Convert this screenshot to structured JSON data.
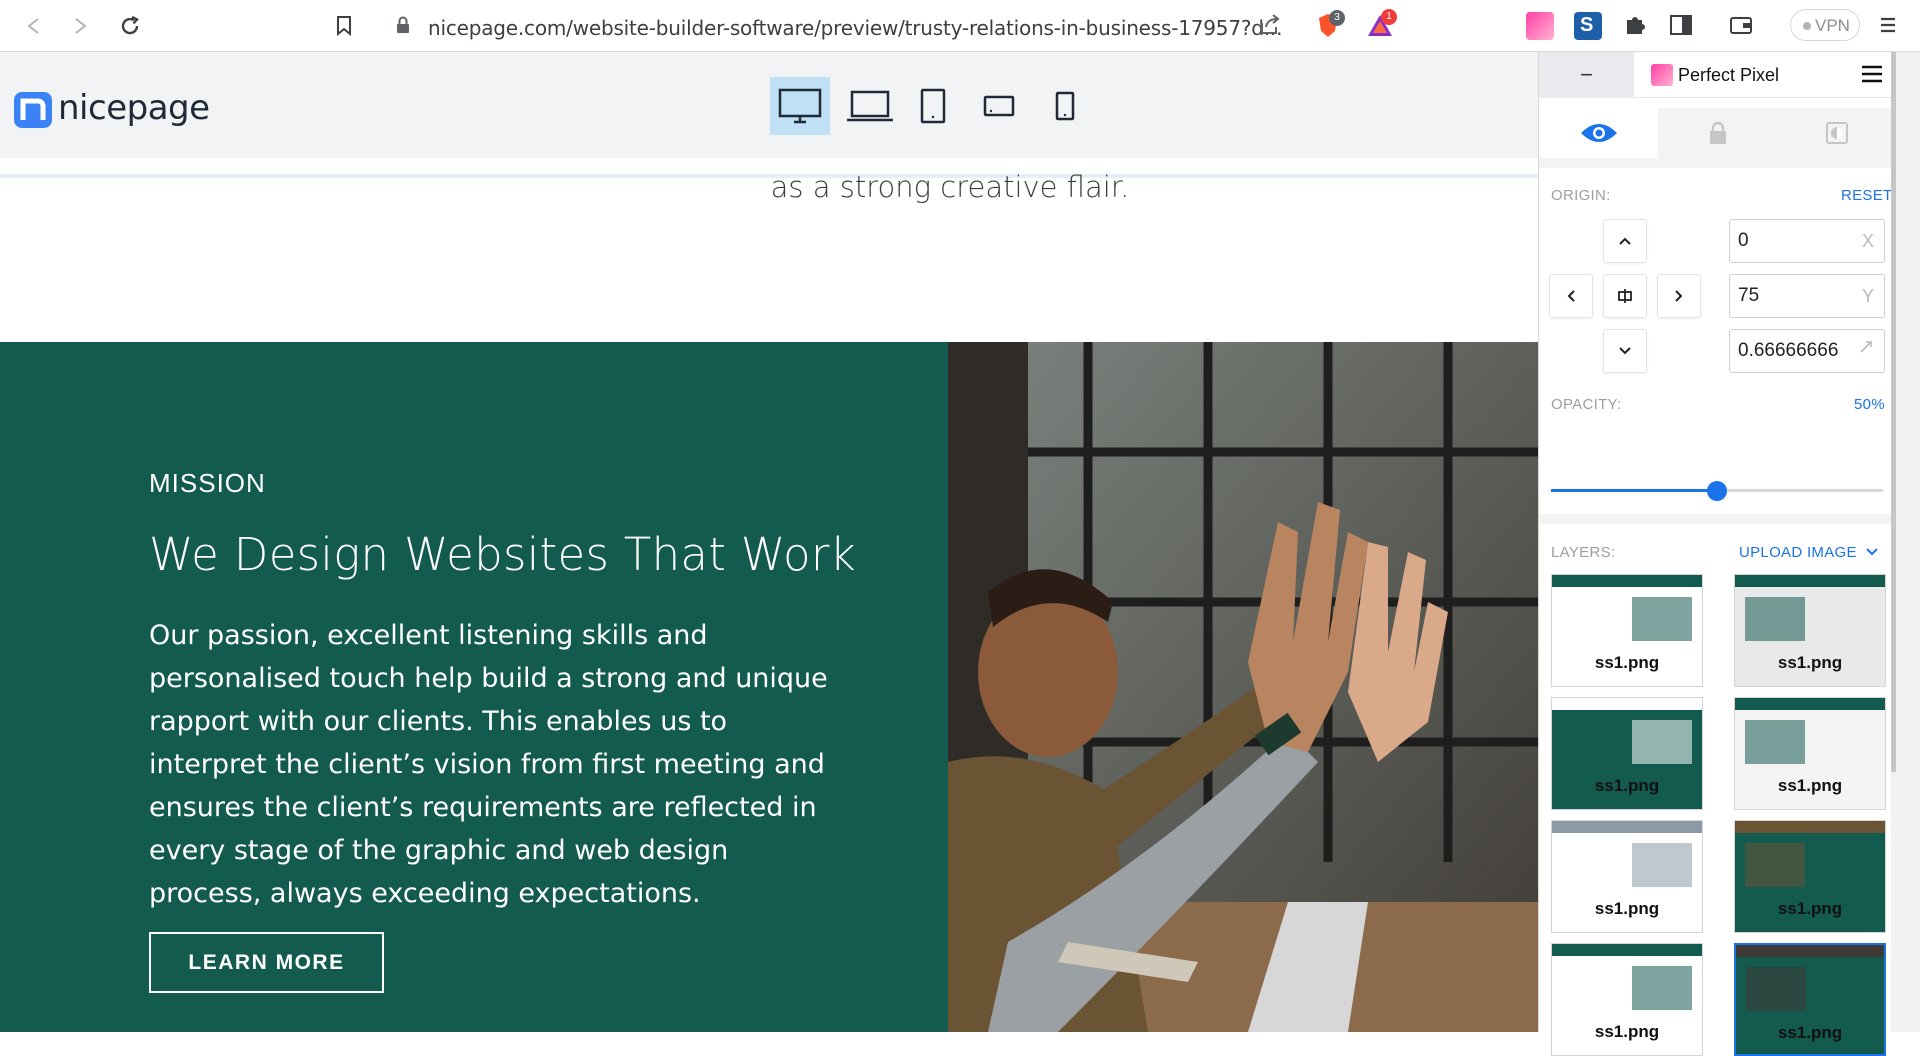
{
  "browser": {
    "url": "nicepage.com/website-builder-software/preview/trusty-relations-in-business-17957?d...",
    "brave_badge": "3",
    "rewards_badge": "1",
    "vpn_label": "VPN"
  },
  "site": {
    "logo_text": "nicepage",
    "devices": [
      "desktop-icon",
      "laptop-icon",
      "tablet-icon",
      "tablet-landscape-icon",
      "phone-icon"
    ]
  },
  "page": {
    "strip_text": "as a strong creative flair.",
    "mission_label": "MISSION",
    "mission_title": "We Design Websites That Work",
    "mission_body": "Our passion, excellent listening skills and personalised touch help build a strong and unique rapport with our clients. This enables us to interpret the client’s vision from first meeting and ensures the client’s requirements are reflected in every stage of the graphic and web design process, always exceeding expectations.",
    "learn_more": "LEARN MORE",
    "panel_color": "#135a4f"
  },
  "perfect_pixel": {
    "title": "Perfect Pixel",
    "minus": "−",
    "origin_label": "ORIGIN:",
    "reset_label": "RESET",
    "x_value": "0",
    "x_unit": "X",
    "y_value": "75",
    "y_unit": "Y",
    "scale_value": "0.66666666",
    "opacity_label": "OPACITY:",
    "opacity_value": "50%",
    "opacity_fraction": 0.5,
    "layers_label": "LAYERS:",
    "upload_label": "UPLOAD IMAGE",
    "layers": [
      {
        "name": "ss1.png"
      },
      {
        "name": "ss1.png"
      },
      {
        "name": "ss1.png"
      },
      {
        "name": "ss1.png"
      },
      {
        "name": "ss1.png"
      },
      {
        "name": "ss1.png"
      },
      {
        "name": "ss1.png"
      },
      {
        "name": "ss1.png"
      }
    ],
    "accent": "#1a73e8"
  }
}
